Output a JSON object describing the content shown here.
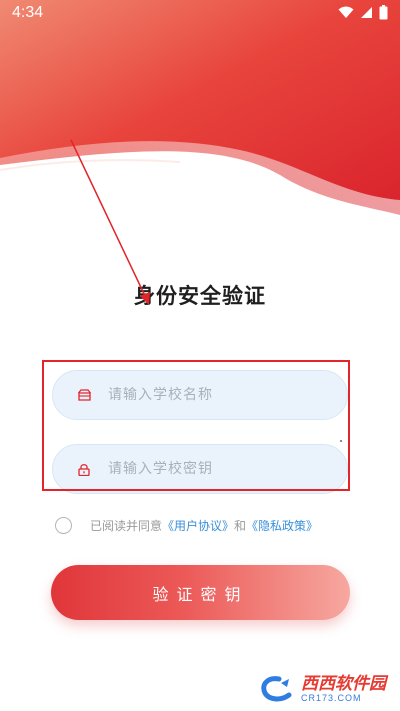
{
  "status_bar": {
    "time": "4:34",
    "icons": [
      "wifi-icon",
      "signal-icon",
      "battery-icon"
    ]
  },
  "page": {
    "title": "身份安全验证"
  },
  "form": {
    "school_name": {
      "placeholder": "请输入学校名称",
      "value": "",
      "icon": "school-icon"
    },
    "school_key": {
      "placeholder": "请输入学校密钥",
      "value": "",
      "icon": "lock-icon"
    }
  },
  "agreement": {
    "prefix": "已阅读并同意",
    "user_agreement": "《用户协议》",
    "conjunction": "和",
    "privacy_policy": "《隐私政策》",
    "checked": false
  },
  "submit_label": "验证密钥",
  "watermark": {
    "brand": "西西软件园",
    "url": "CR173.COM"
  },
  "colors": {
    "primary": "#e2242b",
    "link": "#3a8fd9",
    "field_bg": "#eaf3fc"
  }
}
